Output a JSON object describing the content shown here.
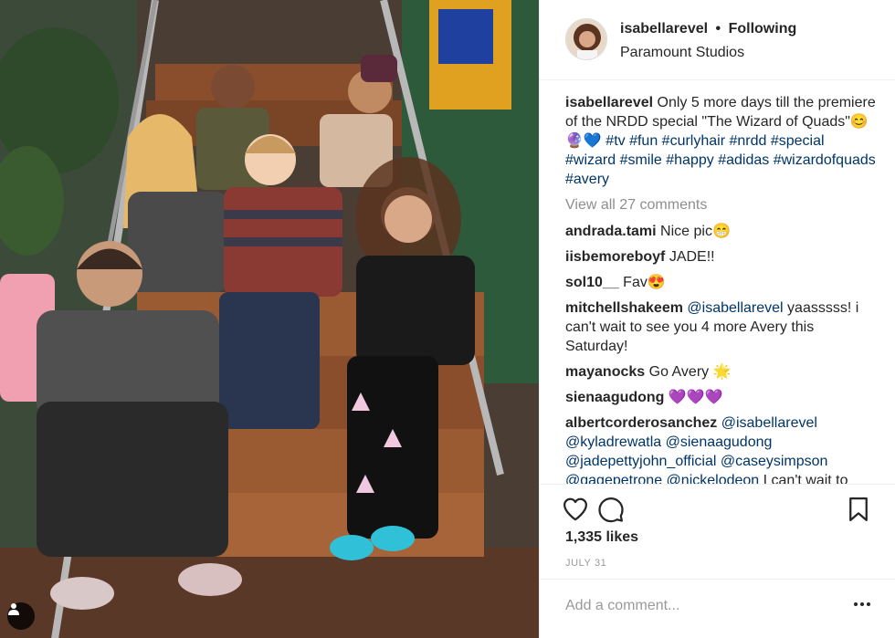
{
  "header": {
    "username": "isabellarevel",
    "separator": "•",
    "follow_status": "Following",
    "location": "Paramount Studios"
  },
  "caption": {
    "username": "isabellarevel",
    "text": "Only 5 more days till the premiere of the NRDD special \"The Wizard of Quads\"😊🔮💙",
    "hashtags": "#tv #fun #curlyhair #nrdd #special #wizard #smile #happy #adidas #wizardofquads #avery"
  },
  "view_all_comments": "View all 27 comments",
  "comments": [
    {
      "user": "andrada.tami",
      "text": "Nice pic😁"
    },
    {
      "user": "iisbemoreboyf",
      "text": "JADE!!"
    },
    {
      "user": "sol10__",
      "text": "Fav😍"
    },
    {
      "user": "mitchellshakeem",
      "mention": "@isabellarevel",
      "text": " yaasssss! i can't wait to see you 4 more Avery this Saturday!"
    },
    {
      "user": "mayanocks",
      "text": "Go Avery 🌟"
    },
    {
      "user": "sienaagudong",
      "text": "💜💜💜"
    },
    {
      "user": "albertcorderosanchez",
      "mention": "@isabellarevel @kyladrewatla @sienaagudong @jadepettyjohn_official @caseysimpson @gagepetrone @nickelodeon",
      "text": " I can't wait to"
    }
  ],
  "actions": {
    "like_icon": "heart-icon",
    "comment_icon": "comment-icon",
    "save_icon": "bookmark-icon"
  },
  "likes": "1,335 likes",
  "date": "JULY 31",
  "add_comment": {
    "placeholder": "Add a comment..."
  },
  "colors": {
    "link": "#003569",
    "muted": "#8e8e8e",
    "text": "#262626",
    "border": "#efefef"
  }
}
